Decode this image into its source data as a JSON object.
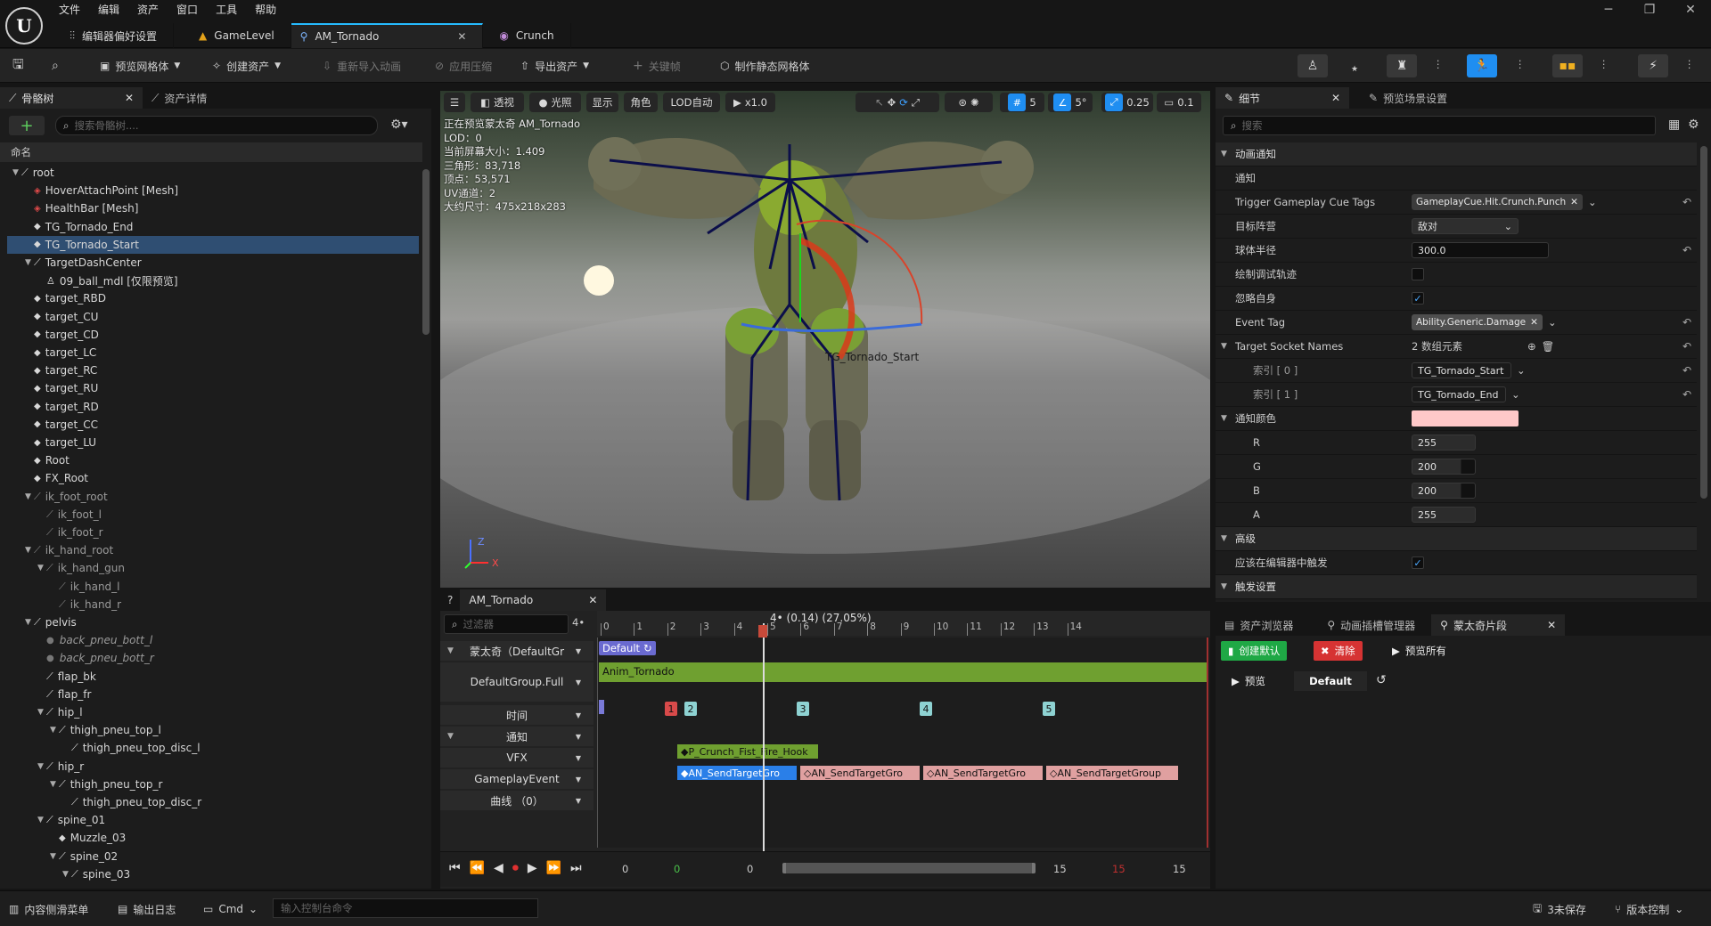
{
  "menu": [
    "文件",
    "编辑",
    "资产",
    "窗口",
    "工具",
    "帮助"
  ],
  "window_controls": [
    "─",
    "❐",
    "✕"
  ],
  "tabs": [
    {
      "label": "编辑器偏好设置",
      "icon": "sliders-icon"
    },
    {
      "label": "GameLevel",
      "icon": "level-icon"
    },
    {
      "label": "AM_Tornado",
      "icon": "anim-montage-icon",
      "close": "✕"
    },
    {
      "label": "Crunch",
      "icon": "character-icon"
    }
  ],
  "toolbar": {
    "preview_mesh": "预览网格体",
    "create_asset": "创建资产",
    "reimport": "重新导入动画",
    "apply_compress": "应用压缩",
    "export_asset": "导出资产",
    "keyframe": "关键帧",
    "make_static_mesh": "制作静态网格体"
  },
  "skeleton_panel": {
    "tab1": "骨骼树",
    "tab2": "资产详情",
    "close": "✕",
    "add": "+",
    "search_placeholder": "搜索骨骼树....",
    "column": "命名",
    "rows": [
      {
        "label": "root",
        "indent": 0,
        "kind": "bone",
        "arrow": "▼"
      },
      {
        "label": "HoverAttachPoint [Mesh]",
        "indent": 1,
        "kind": "mesh"
      },
      {
        "label": "HealthBar [Mesh]",
        "indent": 1,
        "kind": "mesh"
      },
      {
        "label": "TG_Tornado_End",
        "indent": 1,
        "kind": "socket"
      },
      {
        "label": "TG_Tornado_Start",
        "indent": 1,
        "kind": "socket",
        "state": "sel"
      },
      {
        "label": "TargetDashCenter",
        "indent": 1,
        "kind": "bone",
        "arrow": "▼"
      },
      {
        "label": "09_ball_mdl [仅限预览]",
        "indent": 2,
        "kind": "person"
      },
      {
        "label": "target_RBD",
        "indent": 1,
        "kind": "socket"
      },
      {
        "label": "target_CU",
        "indent": 1,
        "kind": "socket"
      },
      {
        "label": "target_CD",
        "indent": 1,
        "kind": "socket"
      },
      {
        "label": "target_LC",
        "indent": 1,
        "kind": "socket"
      },
      {
        "label": "target_RC",
        "indent": 1,
        "kind": "socket"
      },
      {
        "label": "target_RU",
        "indent": 1,
        "kind": "socket"
      },
      {
        "label": "target_RD",
        "indent": 1,
        "kind": "socket"
      },
      {
        "label": "target_CC",
        "indent": 1,
        "kind": "socket"
      },
      {
        "label": "target_LU",
        "indent": 1,
        "kind": "socket"
      },
      {
        "label": "Root",
        "indent": 1,
        "kind": "socket"
      },
      {
        "label": "FX_Root",
        "indent": 1,
        "kind": "socket"
      },
      {
        "label": "ik_foot_root",
        "indent": 1,
        "kind": "bonedim",
        "arrow": "▼"
      },
      {
        "label": "ik_foot_l",
        "indent": 2,
        "kind": "bonedim"
      },
      {
        "label": "ik_foot_r",
        "indent": 2,
        "kind": "bonedim"
      },
      {
        "label": "ik_hand_root",
        "indent": 1,
        "kind": "bonedim",
        "arrow": "▼"
      },
      {
        "label": "ik_hand_gun",
        "indent": 2,
        "kind": "bonedim",
        "arrow": "▼"
      },
      {
        "label": "ik_hand_l",
        "indent": 3,
        "kind": "bonedim"
      },
      {
        "label": "ik_hand_r",
        "indent": 3,
        "kind": "bonedim"
      },
      {
        "label": "pelvis",
        "indent": 1,
        "kind": "bone",
        "arrow": "▼"
      },
      {
        "label": "back_pneu_bott_l",
        "indent": 2,
        "kind": "dot",
        "state": "ital"
      },
      {
        "label": "back_pneu_bott_r",
        "indent": 2,
        "kind": "dot",
        "state": "ital"
      },
      {
        "label": "flap_bk",
        "indent": 2,
        "kind": "bone"
      },
      {
        "label": "flap_fr",
        "indent": 2,
        "kind": "bone"
      },
      {
        "label": "hip_l",
        "indent": 2,
        "kind": "bone",
        "arrow": "▼"
      },
      {
        "label": "thigh_pneu_top_l",
        "indent": 3,
        "kind": "bone",
        "arrow": "▼"
      },
      {
        "label": "thigh_pneu_top_disc_l",
        "indent": 4,
        "kind": "bone"
      },
      {
        "label": "hip_r",
        "indent": 2,
        "kind": "bone",
        "arrow": "▼"
      },
      {
        "label": "thigh_pneu_top_r",
        "indent": 3,
        "kind": "bone",
        "arrow": "▼"
      },
      {
        "label": "thigh_pneu_top_disc_r",
        "indent": 4,
        "kind": "bone"
      },
      {
        "label": "spine_01",
        "indent": 2,
        "kind": "bone",
        "arrow": "▼"
      },
      {
        "label": "Muzzle_03",
        "indent": 3,
        "kind": "socket"
      },
      {
        "label": "spine_02",
        "indent": 3,
        "kind": "bone",
        "arrow": "▼"
      },
      {
        "label": "spine_03",
        "indent": 4,
        "kind": "bone",
        "arrow": "▼"
      }
    ]
  },
  "viewport": {
    "buttons": {
      "perspective": "透视",
      "lit": "光照",
      "show": "显示",
      "character": "角色",
      "lod": "LOD自动",
      "speed": "x1.0"
    },
    "right_values": {
      "grid": "5",
      "angle": "5°",
      "scale": "0.25",
      "cam": "0.1"
    },
    "info": [
      "正在预览蒙太奇 AM_Tornado",
      "LOD：0",
      "当前屏幕大小：1.409",
      "三角形：83,718",
      "顶点：53,571",
      "UV通道：2",
      "大约尺寸：475x218x283"
    ],
    "socket_label": "TG_Tornado_Start",
    "axis_x": "X",
    "axis_z": "Z"
  },
  "timeline": {
    "tab": "AM_Tornado",
    "close": "✕",
    "filter_placeholder": "过滤器",
    "frame_counter": "4•",
    "playhead_label": "4• (0.14) (27.05%)",
    "ticks": [
      "0",
      "1",
      "2",
      "3",
      "4",
      "5",
      "6",
      "7",
      "8",
      "9",
      "10",
      "11",
      "12",
      "13",
      "14"
    ],
    "tracks": {
      "montage": "蒙太奇（DefaultGr",
      "group": "DefaultGroup.Full",
      "time": "时间",
      "notify": "通知",
      "vfx": "VFX",
      "gameplay": "GameplayEvent",
      "curves": "曲线 （0）"
    },
    "section_default": "Default",
    "segment": "Anim_Tornado",
    "markers": [
      "1",
      "2",
      "3",
      "4",
      "5"
    ],
    "vfx_notify": "P_Crunch_Fist_Fire_Hook",
    "gameplay_notifies": [
      "AN_SendTargetGro",
      "AN_SendTargetGro",
      "AN_SendTargetGro",
      "AN_SendTargetGroup"
    ],
    "transport_nums": {
      "start": "0",
      "green": "0",
      "cur": "0",
      "end1": "15",
      "red": "15",
      "end2": "15"
    }
  },
  "details": {
    "tab1": "细节",
    "tab2": "预览场景设置",
    "close": "✕",
    "search_placeholder": "搜索",
    "cat_anim_notify": "动画通知",
    "notify": "通知",
    "cue_label": "Trigger Gameplay Cue Tags",
    "cue_value": "GameplayCue.Hit.Crunch.Punch",
    "camp_label": "目标阵营",
    "camp_value": "敌对",
    "radius_label": "球体半径",
    "radius_value": "300.0",
    "debug_label": "绘制调试轨迹",
    "ignore_label": "忽略自身",
    "event_tag_label": "Event Tag",
    "event_tag_value": "Ability.Generic.Damage",
    "socket_names_label": "Target Socket Names",
    "socket_names_value": "2 数组元素",
    "index0_label": "索引 [ 0 ]",
    "index0_value": "TG_Tornado_Start",
    "index1_label": "索引 [ 1 ]",
    "index1_value": "TG_Tornado_End",
    "color_label": "通知颜色",
    "color_hex": "#ffc8c8",
    "r_label": "R",
    "r": "255",
    "g_label": "G",
    "g": "200",
    "b_label": "B",
    "b": "200",
    "a_label": "A",
    "a": "255",
    "advanced": "高级",
    "trigger_editor": "应该在编辑器中触发",
    "trigger_settings": "触发设置"
  },
  "bottom_right": {
    "tab1": "资产浏览器",
    "tab2": "动画插槽管理器",
    "tab3": "蒙太奇片段",
    "close": "✕",
    "create_default": "创建默认",
    "clear": "清除",
    "preview_all": "预览所有",
    "preview": "预览",
    "default": "Default"
  },
  "statusbar": {
    "content_drawer": "内容侧滑菜单",
    "output_log": "输出日志",
    "cmd": "Cmd",
    "console_placeholder": "输入控制台命令",
    "unsaved": "3未保存",
    "source_control": "版本控制"
  }
}
